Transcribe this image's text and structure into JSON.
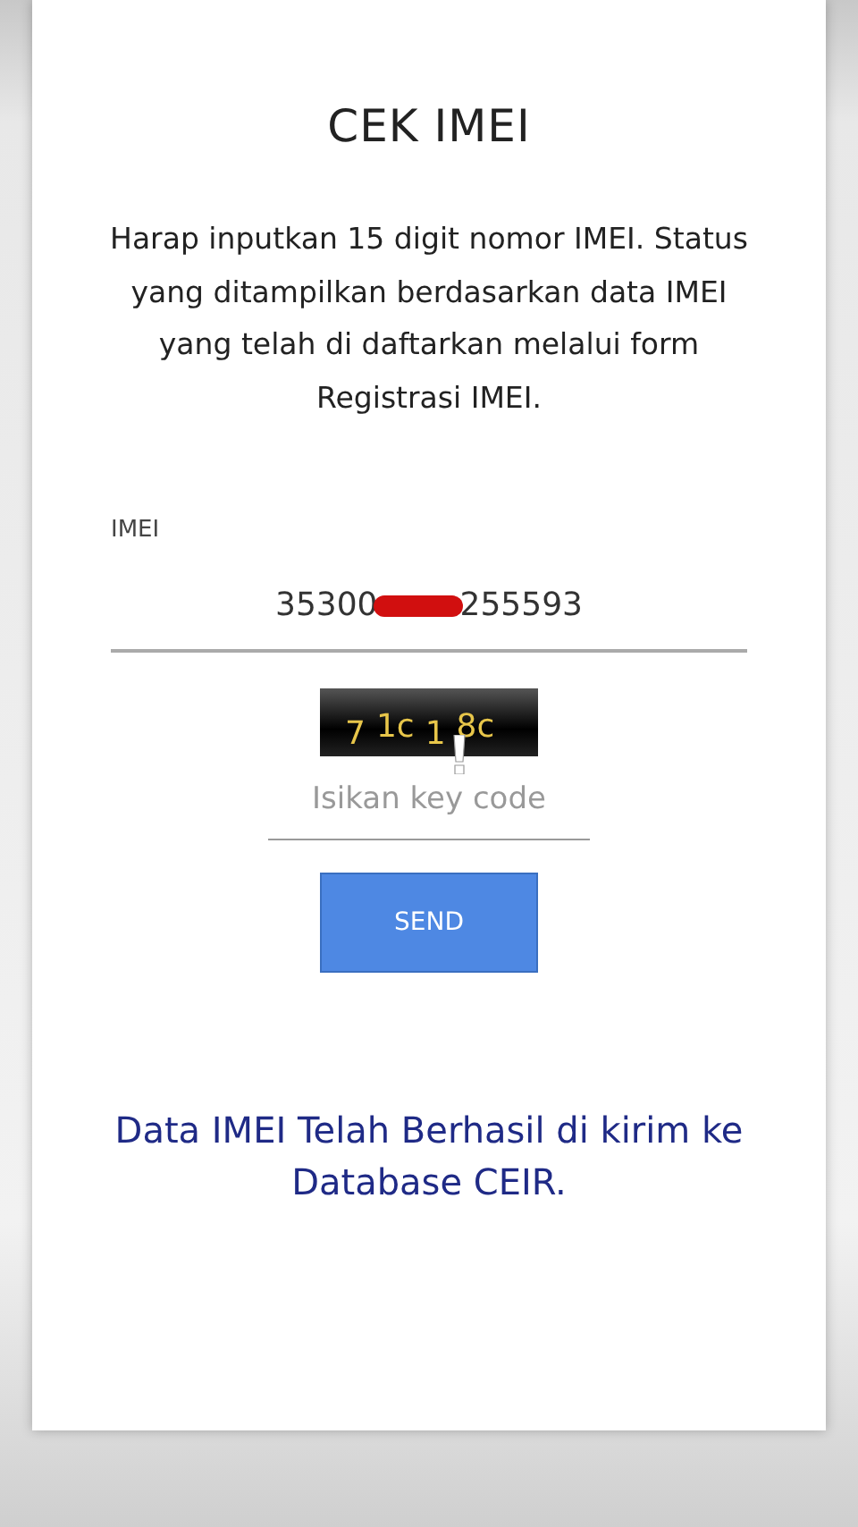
{
  "title": "CEK IMEI",
  "description": "Harap inputkan 15 digit nomor IMEI. Status yang ditampilkan berdasarkan data IMEI yang telah di daftarkan melalui form Registrasi IMEI.",
  "imei": {
    "label": "IMEI",
    "value_start": "35300",
    "value_end": "255593"
  },
  "captcha": {
    "characters": [
      "7",
      "1c",
      "1",
      "8c"
    ]
  },
  "key_code": {
    "placeholder": "Isikan key code"
  },
  "send_button": "SEND",
  "message": "Data IMEI Telah Berhasil di kirim ke Database CEIR."
}
